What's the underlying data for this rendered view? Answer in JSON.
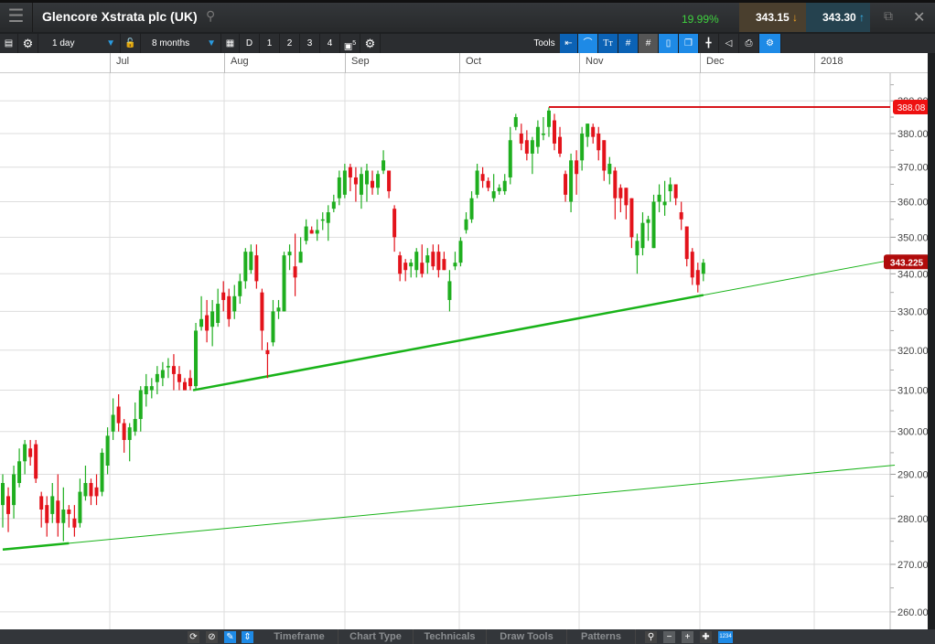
{
  "header": {
    "title": "Glencore Xstrata plc (UK)",
    "change_pct": "19.99%",
    "sell_price": "343.15",
    "buy_price": "343.30"
  },
  "toolbar": {
    "interval": "1 day",
    "range": "8 months",
    "buttons": [
      "D",
      "1",
      "2",
      "3",
      "4"
    ],
    "save_badge": "5",
    "tools_label": "Tools"
  },
  "date_axis": [
    "Jul",
    "Aug",
    "Sep",
    "Oct",
    "Nov",
    "Dec",
    "2018"
  ],
  "bottom_bar": {
    "tabs": [
      "Timeframe",
      "Chart Type",
      "Technicals",
      "Draw Tools",
      "Patterns"
    ],
    "badge": "1234"
  },
  "colors": {
    "up": "#1fae1f",
    "down": "#e3131b",
    "trend": "#19b319",
    "resistance": "#d8161c"
  },
  "chart_data": {
    "type": "candlestick",
    "scale": "log",
    "y_ticks": [
      "260.00",
      "270.00",
      "280.00",
      "290.00",
      "300.00",
      "310.00",
      "320.00",
      "330.00",
      "340.00",
      "350.00",
      "360.00",
      "370.00",
      "380.00",
      "390.00"
    ],
    "y_tick_values": [
      260,
      270,
      280,
      290,
      300,
      310,
      320,
      330,
      340,
      350,
      360,
      370,
      380,
      390
    ],
    "last_price_label": "343.225",
    "last_price": 343.225,
    "resistance": {
      "label": "388.08",
      "value": 388.08,
      "from_index": 99
    },
    "trendlines": [
      {
        "p1": [
          0,
          273.2
        ],
        "p2": [
          161.7,
          292.1
        ],
        "thick_until": 12
      },
      {
        "p1": [
          34.5,
          310
        ],
        "p2": [
          127,
          334.3
        ],
        "extend_to": 161.7
      }
    ],
    "candles_ohlc_fields": [
      "open",
      "close",
      "high",
      "low"
    ],
    "candles": [
      [
        283,
        288,
        290,
        278
      ],
      [
        285,
        281,
        287,
        277
      ],
      [
        283,
        290,
        292,
        280
      ],
      [
        288,
        293,
        296,
        287
      ],
      [
        293,
        297,
        298,
        290
      ],
      [
        296,
        294,
        298,
        292
      ],
      [
        297,
        289,
        298,
        288
      ],
      [
        285,
        282,
        286,
        278
      ],
      [
        283,
        279,
        285,
        276
      ],
      [
        281,
        285,
        288,
        279
      ],
      [
        284,
        279,
        290,
        276
      ],
      [
        279,
        282,
        287,
        275
      ],
      [
        282,
        281,
        283,
        278
      ],
      [
        280,
        278,
        283,
        276
      ],
      [
        279,
        286,
        289,
        278
      ],
      [
        285,
        288,
        292,
        284
      ],
      [
        288,
        285,
        289,
        283
      ],
      [
        287,
        285,
        290,
        283
      ],
      [
        286,
        295,
        296,
        285
      ],
      [
        292,
        299,
        301,
        290
      ],
      [
        300,
        304,
        308,
        298
      ],
      [
        306,
        302,
        309,
        300
      ],
      [
        302,
        298,
        303,
        295
      ],
      [
        298,
        301,
        302,
        293
      ],
      [
        300,
        303,
        307,
        299
      ],
      [
        303,
        310,
        311,
        300
      ],
      [
        309,
        311,
        314,
        306
      ],
      [
        310,
        311,
        313,
        308
      ],
      [
        312,
        314,
        316,
        309
      ],
      [
        313,
        315,
        317,
        311
      ],
      [
        316,
        316,
        318,
        313
      ],
      [
        316,
        314,
        319,
        310
      ],
      [
        314,
        312,
        316,
        310
      ],
      [
        312,
        310,
        313,
        310
      ],
      [
        313,
        311,
        315,
        310
      ],
      [
        311,
        325,
        327,
        310
      ],
      [
        326,
        328,
        334,
        325
      ],
      [
        329,
        325,
        333,
        322
      ],
      [
        326,
        330,
        333,
        321
      ],
      [
        327,
        332,
        336,
        326
      ],
      [
        335,
        333,
        338,
        330
      ],
      [
        334,
        328,
        336,
        326
      ],
      [
        330,
        334,
        337,
        328
      ],
      [
        334,
        338,
        340,
        332
      ],
      [
        338,
        346,
        347,
        336
      ],
      [
        341,
        346,
        348,
        340
      ],
      [
        345,
        338,
        348,
        336
      ],
      [
        335,
        325,
        336,
        320
      ],
      [
        320,
        319,
        322,
        313
      ],
      [
        322,
        330,
        333,
        321
      ],
      [
        330,
        331,
        333,
        328
      ],
      [
        330,
        345,
        346,
        330
      ],
      [
        345,
        346,
        348,
        341
      ],
      [
        342,
        339,
        351,
        334
      ],
      [
        343,
        346,
        350,
        343
      ],
      [
        349,
        353,
        355,
        348
      ],
      [
        352,
        351,
        353,
        351
      ],
      [
        351,
        352,
        355,
        349
      ],
      [
        355,
        355,
        357,
        352
      ],
      [
        354,
        357,
        359,
        349
      ],
      [
        358,
        360,
        362,
        357
      ],
      [
        361,
        367,
        369,
        359
      ],
      [
        362,
        369,
        371,
        361
      ],
      [
        370,
        367,
        371,
        363
      ],
      [
        367,
        365,
        370,
        360
      ],
      [
        362,
        368,
        370,
        358
      ],
      [
        365,
        369,
        371,
        360
      ],
      [
        366,
        364,
        369,
        362
      ],
      [
        364,
        368,
        369,
        362
      ],
      [
        369,
        372,
        375,
        368
      ],
      [
        369,
        363,
        369,
        361
      ],
      [
        358,
        350,
        359,
        346
      ],
      [
        345,
        340,
        346,
        338
      ],
      [
        343,
        341,
        344,
        338
      ],
      [
        342,
        343,
        344,
        339
      ],
      [
        341,
        346,
        347,
        339
      ],
      [
        343,
        340,
        348,
        339
      ],
      [
        343,
        345,
        347,
        340
      ],
      [
        346,
        342,
        348,
        341
      ],
      [
        346,
        341,
        348,
        339
      ],
      [
        344,
        341,
        346,
        341
      ],
      [
        333,
        338,
        341,
        330
      ],
      [
        342,
        343,
        346,
        341
      ],
      [
        343,
        349,
        350,
        342
      ],
      [
        352,
        355,
        357,
        351
      ],
      [
        355,
        361,
        363,
        354
      ],
      [
        362,
        369,
        371,
        361
      ],
      [
        368,
        366,
        370,
        364
      ],
      [
        366,
        364,
        367,
        363
      ],
      [
        361,
        363,
        368,
        360
      ],
      [
        363,
        364,
        365,
        362
      ],
      [
        363,
        366,
        368,
        362
      ],
      [
        367,
        378,
        382,
        365
      ],
      [
        382,
        385,
        386,
        381
      ],
      [
        380,
        377,
        383,
        375
      ],
      [
        378,
        374,
        381,
        372
      ],
      [
        374,
        378,
        379,
        368
      ],
      [
        376,
        382,
        384,
        374
      ],
      [
        380,
        380,
        385,
        378
      ],
      [
        382,
        387,
        388,
        379
      ],
      [
        384,
        377,
        386,
        375
      ],
      [
        379,
        374,
        382,
        373
      ],
      [
        368,
        362,
        369,
        360
      ],
      [
        360,
        372,
        374,
        357
      ],
      [
        372,
        368,
        375,
        362
      ],
      [
        372,
        380,
        382,
        369
      ],
      [
        379,
        383,
        383,
        376
      ],
      [
        382,
        379,
        383,
        377
      ],
      [
        380,
        375,
        382,
        372
      ],
      [
        378,
        369,
        378,
        366
      ],
      [
        368,
        371,
        373,
        365
      ],
      [
        369,
        361,
        370,
        355
      ],
      [
        364,
        361,
        365,
        357
      ],
      [
        364,
        359,
        364,
        355
      ],
      [
        361,
        350,
        361,
        347
      ],
      [
        345,
        349,
        351,
        340
      ],
      [
        347,
        354,
        357,
        345
      ],
      [
        354,
        355,
        356,
        349
      ],
      [
        347,
        360,
        362,
        347
      ],
      [
        360,
        362,
        365,
        357
      ],
      [
        359,
        360,
        366,
        356
      ],
      [
        363,
        365,
        367,
        360
      ],
      [
        365,
        361,
        365,
        359
      ],
      [
        357,
        355,
        360,
        352
      ],
      [
        353,
        344,
        353,
        342
      ],
      [
        346,
        339,
        347,
        337
      ],
      [
        341,
        337,
        343,
        335
      ],
      [
        340,
        343,
        344,
        338
      ]
    ]
  }
}
